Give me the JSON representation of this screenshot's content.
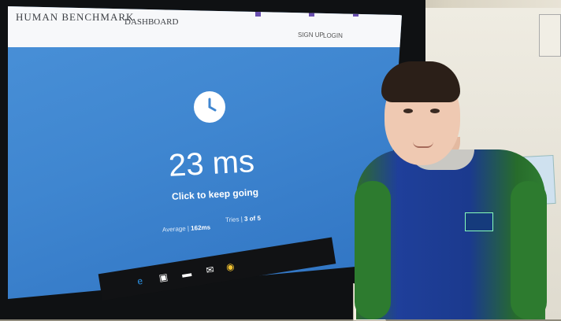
{
  "site": {
    "brand": "HUMAN BENCHMARK",
    "nav_dashboard": "DASHBOARD",
    "signup": "SIGN UP",
    "login": "LOGIN"
  },
  "test": {
    "result": "23 ms",
    "prompt": "Click to keep going",
    "average_label": "Average |",
    "average_value": "162ms",
    "tries_label": "Tries |",
    "tries_value": "3 of 5"
  },
  "colors": {
    "screen_blue": "#3f86d0",
    "jersey_blue": "#1b3a8e",
    "jersey_green": "#2d7b2f"
  },
  "icons": [
    "clock-icon",
    "edge-icon",
    "store-icon",
    "mail-icon",
    "chrome-icon"
  ]
}
